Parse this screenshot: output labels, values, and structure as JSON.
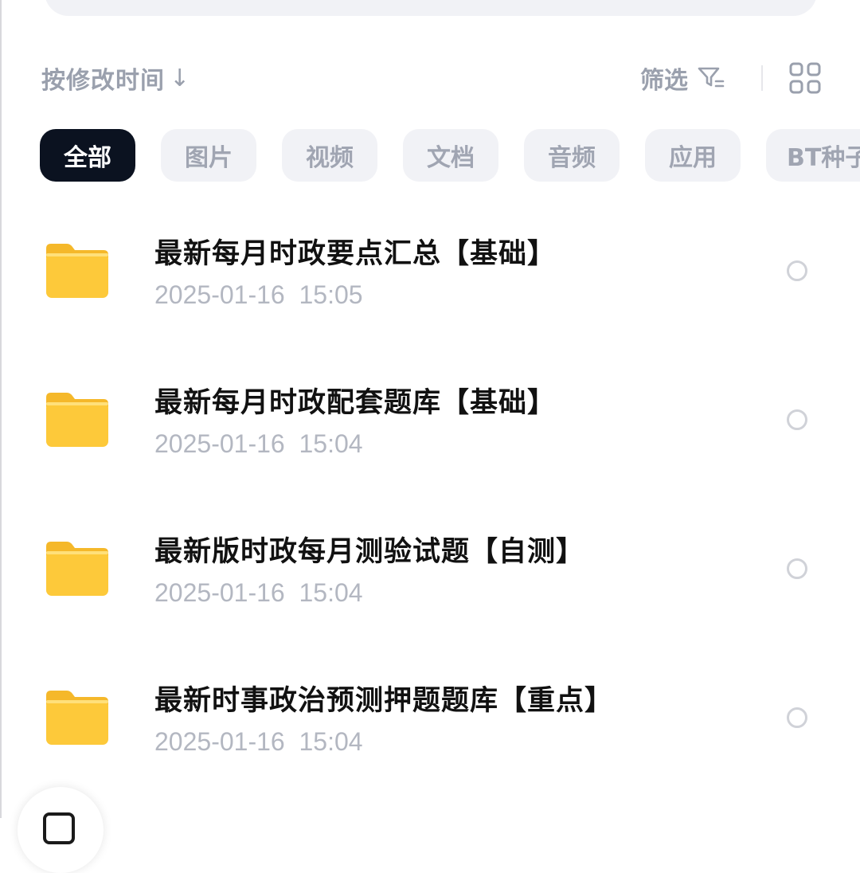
{
  "toolbar": {
    "sort_label": "按修改时间",
    "sort_arrow": "↓",
    "filter_label": "筛选"
  },
  "categories": [
    {
      "label": "全部",
      "active": true
    },
    {
      "label": "图片",
      "active": false
    },
    {
      "label": "视频",
      "active": false
    },
    {
      "label": "文档",
      "active": false
    },
    {
      "label": "音频",
      "active": false
    },
    {
      "label": "应用",
      "active": false
    },
    {
      "label": "BT种子",
      "active": false
    }
  ],
  "files": [
    {
      "name": "最新每月时政要点汇总【基础】",
      "modified": "2025-01-16  15:05",
      "type": "folder-icon",
      "selected": false
    },
    {
      "name": "最新每月时政配套题库【基础】",
      "modified": "2025-01-16  15:04",
      "type": "folder-icon",
      "selected": false
    },
    {
      "name": "最新版时政每月测验试题【自测】",
      "modified": "2025-01-16  15:04",
      "type": "folder-icon",
      "selected": false
    },
    {
      "name": "最新时事政治预测押题题库【重点】",
      "modified": "2025-01-16  15:04",
      "type": "folder-icon",
      "selected": false
    }
  ],
  "colors": {
    "accent_dark": "#0b1220",
    "muted_text": "#9aa0ad",
    "chip_bg": "#f1f2f6",
    "folder_yellow": "#fdc93a"
  }
}
